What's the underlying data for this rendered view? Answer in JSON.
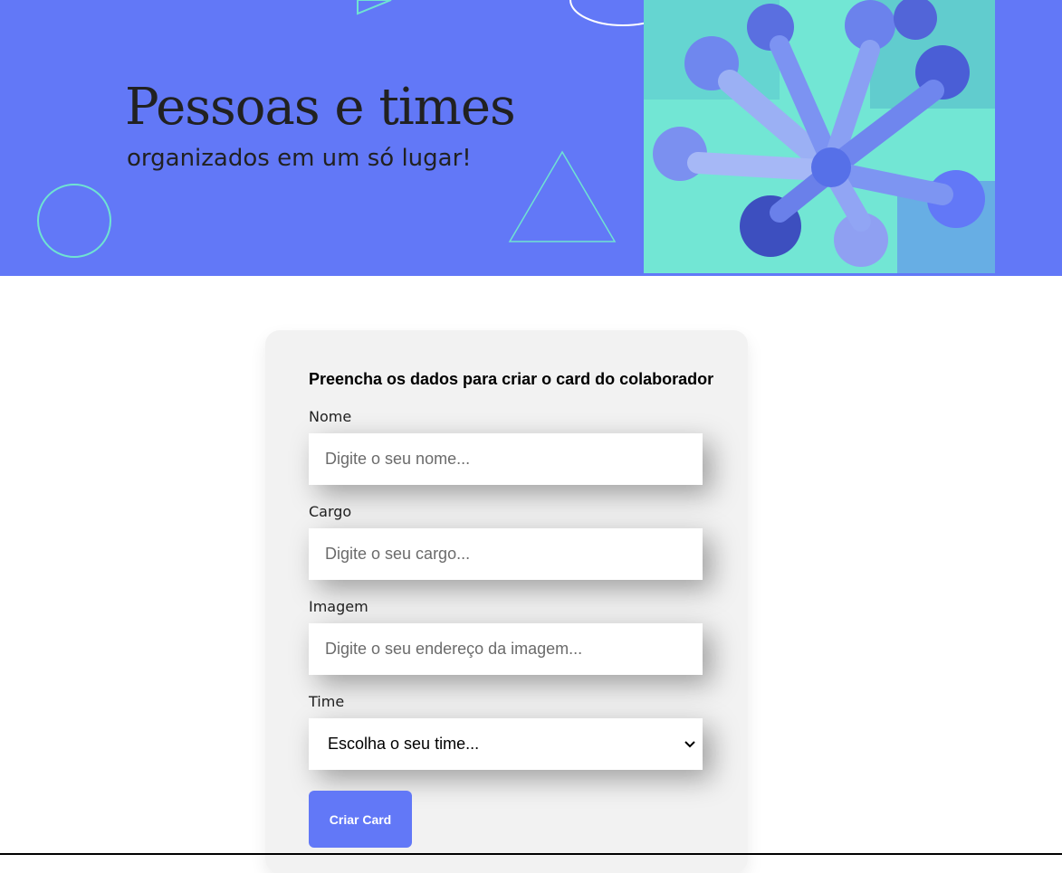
{
  "theme": {
    "accent": "#6278f7",
    "deco_stroke": "#6fe3d2",
    "photo_tint": "#6fe3d2"
  },
  "banner": {
    "title": "Pessoas e times",
    "subtitle": "organizados em um só lugar!",
    "decorations": [
      "circle-outline-icon",
      "triangle-outline-icon",
      "semicircle-outline-icon"
    ],
    "photo": "team-hands-together-photo"
  },
  "form": {
    "title": "Preencha os dados para criar o card do colaborador",
    "fields": {
      "nome": {
        "label": "Nome",
        "placeholder": "Digite o seu nome..."
      },
      "cargo": {
        "label": "Cargo",
        "placeholder": "Digite o seu cargo..."
      },
      "imagem": {
        "label": "Imagem",
        "placeholder": "Digite o seu endereço da imagem..."
      },
      "time": {
        "label": "Time",
        "selected": "Escolha o seu time..."
      }
    },
    "submit_label": "Criar Card"
  }
}
